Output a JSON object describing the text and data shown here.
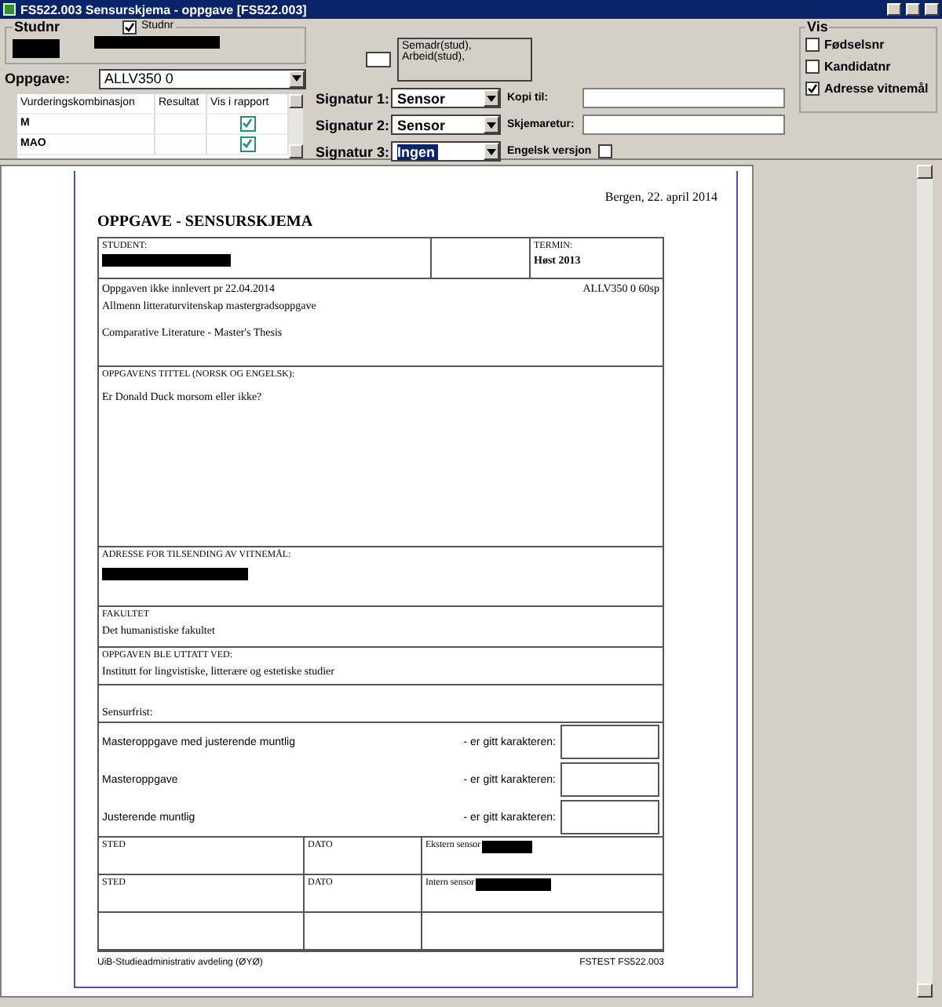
{
  "window": {
    "title": "FS522.003 Sensurskjema - oppgave  [FS522.003]"
  },
  "studnr_group": {
    "label": "Studnr",
    "checkbox": {
      "label": "Studnr",
      "checked": true
    }
  },
  "address_list": [
    "Semadr(stud),",
    "Arbeid(stud),"
  ],
  "oppgave": {
    "label": "Oppgave:",
    "value": "ALLV350 0"
  },
  "assessment_table": {
    "columns": [
      "Vurderingskombinasjon",
      "Resultat",
      "Vis i rapport"
    ],
    "rows": [
      {
        "name": "M",
        "result": "",
        "show_in_report": true
      },
      {
        "name": "MAO",
        "result": "",
        "show_in_report": true
      }
    ]
  },
  "signatures": [
    {
      "label": "Signatur 1:",
      "value": "Sensor",
      "selected": false
    },
    {
      "label": "Signatur 2:",
      "value": "Sensor",
      "selected": false
    },
    {
      "label": "Signatur 3:",
      "value": "Ingen",
      "selected": true
    }
  ],
  "fields": [
    {
      "label": "Kopi til:"
    },
    {
      "label": "Skjemaretur:"
    }
  ],
  "engelsk_versjon": {
    "label": "Engelsk versjon",
    "checked": false
  },
  "vis": {
    "title": "Vis",
    "options": [
      {
        "label": "Fødselsnr",
        "checked": false
      },
      {
        "label": "Kandidatnr",
        "checked": false
      },
      {
        "label": "Adresse vitnemål",
        "checked": true
      }
    ]
  },
  "document": {
    "date": "Bergen, 22. april 2014",
    "title": "OPPGAVE - SENSURSKJEMA",
    "student_label": "STUDENT:",
    "termin_label": "TERMIN:",
    "termin": "Høst 2013",
    "status": "Oppgaven ikke innlevert pr 22.04.2014",
    "course_code": "ALLV350 0   60sp",
    "course_lines": [
      "Allmenn litteraturvitenskap mastergradsoppgave",
      "Comparative Literature - Master's Thesis"
    ],
    "thesis_title_label": "OPPGAVENS TITTEL (NORSK OG ENGELSK):",
    "thesis_title": "Er Donald Duck morsom eller ikke?",
    "address_label": "ADRESSE FOR TILSENDING AV VITNEMÅL:",
    "faculty_label": "FAKULTET",
    "faculty": "Det humanistiske fakultet",
    "institute_label": "OPPGAVEN BLE UTTATT VED:",
    "institute": "Institutt for lingvistiske, litterære og estetiske studier",
    "deadline_label": "Sensurfrist:",
    "grades": [
      {
        "name": "Masteroppgave med justerende muntlig",
        "label": "- er gitt karakteren:"
      },
      {
        "name": "Masteroppgave",
        "label": "- er gitt karakteren:"
      },
      {
        "name": "Justerende muntlig",
        "label": "- er gitt karakteren:"
      }
    ],
    "signature_rows": [
      {
        "place": "STED",
        "date": "DATO",
        "sensor": "Ekstern sensor"
      },
      {
        "place": "STED",
        "date": "DATO",
        "sensor": "Intern sensor"
      }
    ],
    "footer_left": "UiB-Studieadministrativ avdeling (ØYØ)",
    "footer_right": "FSTEST FS522.003"
  }
}
